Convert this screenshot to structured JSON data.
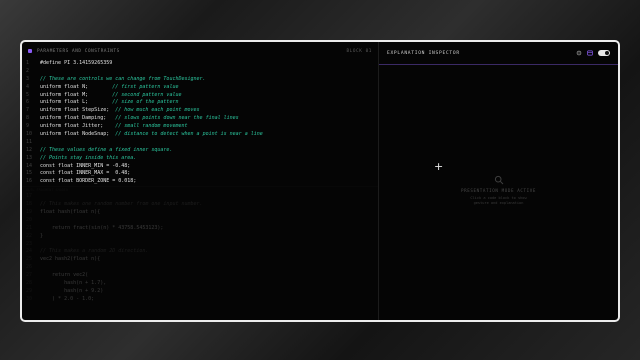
{
  "left_pane": {
    "title": "PARAMETERS AND CONSTRAINTS",
    "note": "BLOCK 01",
    "divider_label": "GLSL FRAGMENT SHADER",
    "code_lines": [
      {
        "n": "1",
        "text": "#define PI 3.14159265359",
        "kind": "code"
      },
      {
        "n": "2",
        "text": "",
        "kind": "blank"
      },
      {
        "n": "3",
        "text": "// These are controls we can change from TouchDesigner.",
        "kind": "comment"
      },
      {
        "n": "4",
        "text": "uniform float N;        // first pattern value",
        "kind": "mixed"
      },
      {
        "n": "5",
        "text": "uniform float M;        // second pattern value",
        "kind": "mixed"
      },
      {
        "n": "6",
        "text": "uniform float L;        // size of the pattern",
        "kind": "mixed"
      },
      {
        "n": "7",
        "text": "uniform float StepSize;  // how much each point moves",
        "kind": "mixed"
      },
      {
        "n": "8",
        "text": "uniform float Damping;   // slows points down near the final lines",
        "kind": "mixed"
      },
      {
        "n": "9",
        "text": "uniform float Jitter;    // small random movement",
        "kind": "mixed"
      },
      {
        "n": "10",
        "text": "uniform float NodeSnap;  // distance to detect when a point is near a line",
        "kind": "mixed"
      },
      {
        "n": "11",
        "text": "",
        "kind": "blank"
      },
      {
        "n": "12",
        "text": "// These values define a fixed inner square.",
        "kind": "comment"
      },
      {
        "n": "13",
        "text": "// Points stay inside this area.",
        "kind": "comment"
      },
      {
        "n": "14",
        "text": "const float INNER_MIN = -0.48;",
        "kind": "code"
      },
      {
        "n": "15",
        "text": "const float INNER_MAX =  0.48;",
        "kind": "code"
      },
      {
        "n": "16",
        "text": "const float BORDER_ZONE = 0.018;",
        "kind": "code"
      }
    ],
    "faded_lines": [
      {
        "n": "17",
        "text": "",
        "kind": "blank"
      },
      {
        "n": "18",
        "text": "// This makes one random number from one input number.",
        "kind": "comment"
      },
      {
        "n": "19",
        "text": "float hash(float n){",
        "kind": "code"
      },
      {
        "n": "20",
        "text": "",
        "kind": "blank"
      },
      {
        "n": "21",
        "text": "    return fract(sin(n) * 43758.5453123);",
        "kind": "code"
      },
      {
        "n": "22",
        "text": "}",
        "kind": "code"
      },
      {
        "n": "23",
        "text": "",
        "kind": "blank"
      },
      {
        "n": "24",
        "text": "// This makes a random 2D direction.",
        "kind": "comment"
      },
      {
        "n": "25",
        "text": "vec2 hash2(float n){",
        "kind": "code"
      },
      {
        "n": "26",
        "text": "",
        "kind": "blank"
      },
      {
        "n": "27",
        "text": "    return vec2(",
        "kind": "code"
      },
      {
        "n": "28",
        "text": "        hash(n + 1.7),",
        "kind": "code"
      },
      {
        "n": "29",
        "text": "        hash(n + 9.2)",
        "kind": "code"
      },
      {
        "n": "30",
        "text": "    ) * 2.0 - 1.0;",
        "kind": "code"
      }
    ]
  },
  "right_pane": {
    "title": "EXPLANATION INSPECTOR",
    "cursor_symbol": "+",
    "empty_title": "PRESENTATION MODE ACTIVE",
    "empty_hint": "Click a code block to show gesture and explanation"
  },
  "icons": {
    "left_header": "purple-square-icon",
    "settings": "gear-icon",
    "layout": "panel-icon",
    "search": "search-icon"
  },
  "colors": {
    "accent": "#8b5cf6",
    "comment": "#2cc9a0",
    "code": "#d0d0d0",
    "frame": "#ececec"
  }
}
